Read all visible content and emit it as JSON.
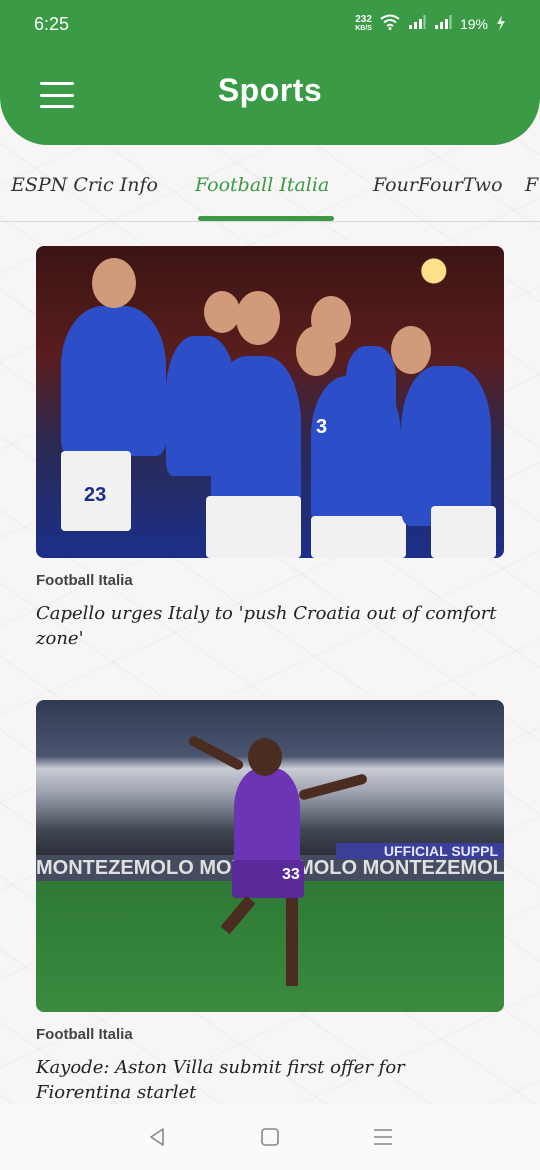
{
  "status_bar": {
    "time": "6:25",
    "net_speed_value": "232",
    "net_speed_unit": "KB/S",
    "battery": "19%"
  },
  "header": {
    "title": "Sports",
    "menu_icon": "hamburger-menu-icon"
  },
  "tabs": [
    {
      "label": "ESPN Cric Info",
      "active": false
    },
    {
      "label": "Football Italia",
      "active": true
    },
    {
      "label": "FourFourTwo",
      "active": false
    },
    {
      "label": "F",
      "active": false
    }
  ],
  "articles": [
    {
      "source": "Football Italia",
      "headline": "Capello urges Italy to 'push Croatia out of comfort zone'",
      "jersey_number": "23",
      "jersey_number_2": "3"
    },
    {
      "source": "Football Italia",
      "headline": "Kayode: Aston Villa submit first offer for Fiorentina starlet",
      "jersey_number": "33",
      "banner_text": "MONTEZEMOLO MONTEZEMOLO MONTEZEMOLO",
      "banner_text_2": "UFFICIAL SUPPL"
    }
  ],
  "nav_bar": {
    "back_icon": "back-triangle-icon",
    "home_icon": "home-square-icon",
    "recents_icon": "recents-lines-icon"
  },
  "colors": {
    "primary": "#3a9a45",
    "background": "#f7f5f6",
    "text": "#222222"
  }
}
